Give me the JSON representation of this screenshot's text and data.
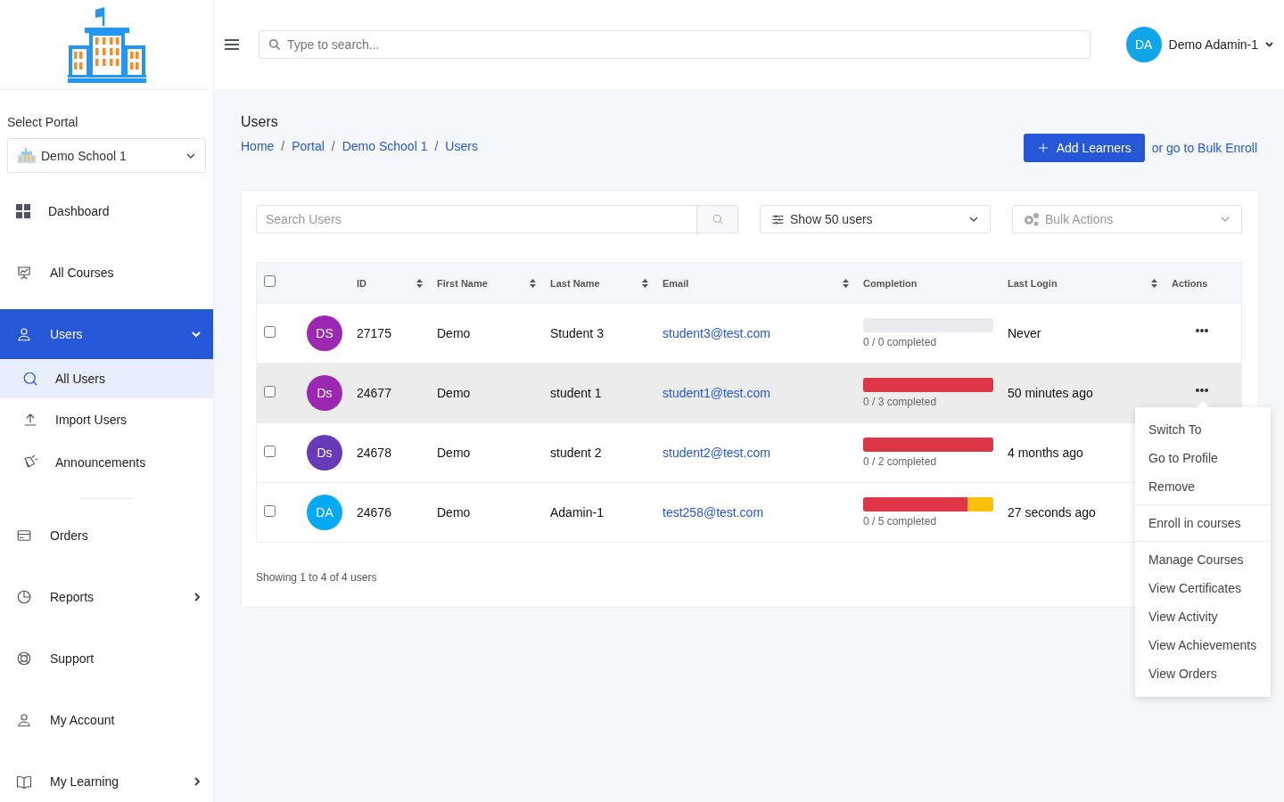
{
  "header": {
    "search": {
      "placeholder": "Type to search..."
    },
    "user": {
      "initials": "DA",
      "name": "Demo Adamin-1",
      "color": "#0ea5e9"
    }
  },
  "sidebar": {
    "portal_label": "Select Portal",
    "portal": "Demo School 1",
    "items": [
      {
        "label": "Dashboard",
        "selected": false
      },
      {
        "label": "All Courses",
        "selected": false
      },
      {
        "label": "Users",
        "selected": true,
        "expanded": true,
        "children": [
          {
            "label": "All Users",
            "selected": true
          },
          {
            "label": "Import Users",
            "selected": false
          },
          {
            "label": "Announcements",
            "selected": false
          }
        ]
      },
      {
        "label": "Orders",
        "selected": false
      },
      {
        "label": "Reports",
        "selected": false,
        "expanded": false
      },
      {
        "label": "Support",
        "selected": false
      },
      {
        "label": "My Account",
        "selected": false
      },
      {
        "label": "My Learning",
        "selected": false,
        "expanded": false
      }
    ]
  },
  "page": {
    "title": "Users",
    "breadcrumbs": [
      "Home",
      "Portal",
      "Demo School 1",
      "Users"
    ],
    "breadcrumb_separator": "/",
    "add_button": "Add Learners",
    "bulk_link": "or go to Bulk Enroll"
  },
  "toolbar": {
    "search": {
      "placeholder": "Search Users"
    },
    "page_size": "Show 50 users",
    "bulk_actions": "Bulk Actions"
  },
  "table": {
    "select_all_checked": false,
    "columns": [
      {
        "label": "ID",
        "sortable": true
      },
      {
        "label": "First Name",
        "sortable": true
      },
      {
        "label": "Last Name",
        "sortable": true
      },
      {
        "label": "Email",
        "sortable": true
      },
      {
        "label": "Completion",
        "sortable": false
      },
      {
        "label": "Last Login",
        "sortable": true
      },
      {
        "label": "Actions",
        "sortable": false
      }
    ],
    "rows": [
      {
        "checked": false,
        "highlighted": false,
        "initials": "DS",
        "color": "#9c27b0",
        "id": "27175",
        "first_name": "Demo",
        "last_name": "Student 3",
        "email": "student3@test.com",
        "progress": {
          "text": "0 / 0 completed"
        },
        "last_login": "Never"
      },
      {
        "checked": false,
        "highlighted": true,
        "initials": "Ds",
        "color": "#9c27b0",
        "id": "24677",
        "first_name": "Demo",
        "last_name": "student 1",
        "email": "student1@test.com",
        "progress": {
          "segments": [
            {
              "color": "#dc3545",
              "level": 1
            }
          ],
          "text": "0 / 3 completed"
        },
        "last_login": "50 minutes ago",
        "menu": [
          [
            "Switch To",
            "Go to Profile",
            "Remove"
          ],
          [
            "Enroll in courses"
          ],
          [
            "Manage Courses",
            "View Certificates",
            "View Activity",
            "View Achievements",
            "View Orders"
          ]
        ]
      },
      {
        "checked": false,
        "highlighted": false,
        "initials": "Ds",
        "color": "#673ab7",
        "id": "24678",
        "first_name": "Demo",
        "last_name": "student 2",
        "email": "student2@test.com",
        "progress": {
          "segments": [
            {
              "color": "#dc3545",
              "level": 1
            }
          ],
          "text": "0 / 2 completed"
        },
        "last_login": "4 months ago"
      },
      {
        "checked": false,
        "highlighted": false,
        "initials": "DA",
        "color": "#03a9f4",
        "id": "24676",
        "first_name": "Demo",
        "last_name": "Adamin-1",
        "email": "test258@test.com",
        "progress": {
          "segments": [
            {
              "color": "#dc3545",
              "level": 0.8
            },
            {
              "color": "#ffc107",
              "level": 0.2
            }
          ],
          "text": "0 / 5 completed"
        },
        "last_login": "27 seconds ago"
      }
    ],
    "footer": "Showing 1 to 4 of 4 users"
  }
}
